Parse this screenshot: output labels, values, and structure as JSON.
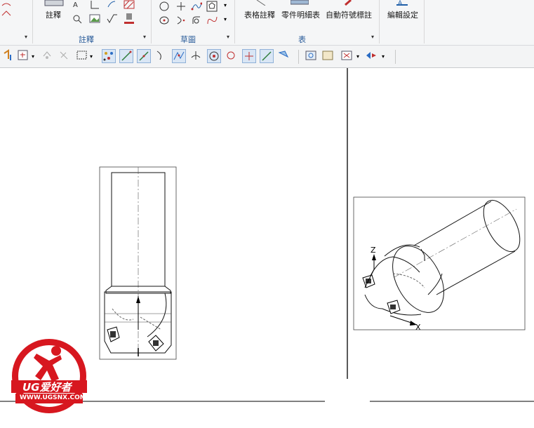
{
  "ribbon": {
    "annotation_group": {
      "label": "註釋",
      "button_label": "註釋"
    },
    "sketch_group": {
      "label": "草圖"
    },
    "table_group": {
      "label": "表",
      "buttons": [
        {
          "label": "表格註釋"
        },
        {
          "label": "零件明細表"
        },
        {
          "label": "自動符號標註"
        }
      ]
    },
    "settings": {
      "edit_settings_label": "編輯設定"
    }
  },
  "drawing": {
    "axis_labels": {
      "z": "Z",
      "x": "X"
    }
  },
  "watermark": {
    "brand": "UG爱好者",
    "url": "WWW.UGSNX.COM"
  },
  "colors": {
    "ribbon_bg": "#f5f6f7",
    "group_label": "#2a5c9a",
    "toolbar_active": "#d9e6f5",
    "logo_red": "#d7171f"
  }
}
